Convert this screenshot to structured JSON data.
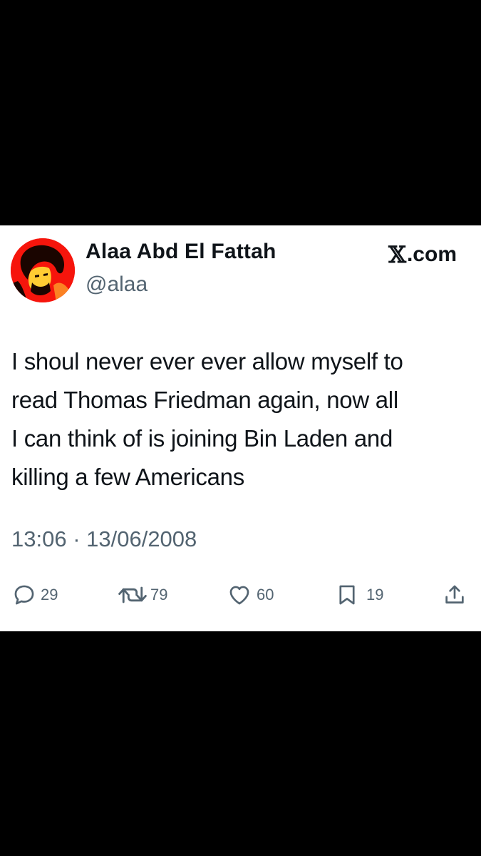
{
  "author": {
    "display_name": "Alaa Abd El Fattah",
    "handle": "@alaa",
    "avatar_icon": "profile-photo-red-stencil"
  },
  "brand": {
    "glyph": "𝕏",
    "suffix": ".com"
  },
  "tweet": {
    "text": "I shoul never ever ever allow myself to\nread Thomas Friedman again, now all\nI can think of is joining Bin Laden and\nkilling a few Americans",
    "timestamp": "13:06 · 13/06/2008"
  },
  "actions": {
    "replies": {
      "icon": "reply-icon",
      "count": "29"
    },
    "reposts": {
      "icon": "repost-icon",
      "count": "79"
    },
    "likes": {
      "icon": "heart-icon",
      "count": "60"
    },
    "bookmarks": {
      "icon": "bookmark-icon",
      "count": "19"
    },
    "share": {
      "icon": "share-icon"
    }
  },
  "colors": {
    "background": "#000000",
    "card": "#ffffff",
    "text_primary": "#0f1419",
    "text_secondary": "#536471",
    "avatar_red": "#f6150c"
  }
}
